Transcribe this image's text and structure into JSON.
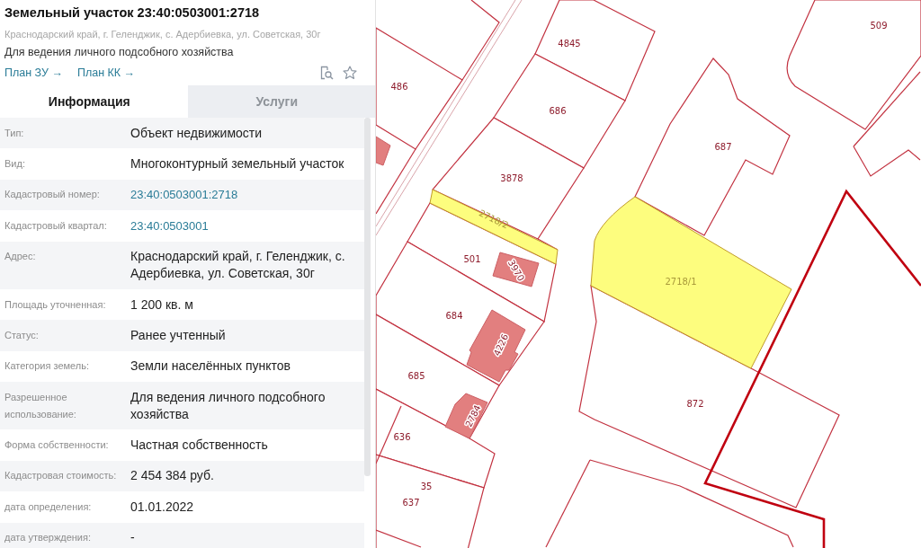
{
  "panel": {
    "title": "Земельный участок 23:40:0503001:2718",
    "address": "Краснодарский край, г. Геленджик, с. Адербиевка, ул. Советская, 30г",
    "purpose": "Для ведения личного подсобного хозяйства",
    "links": [
      "План ЗУ →",
      "План КК →"
    ],
    "tabs": [
      {
        "label": "Информация",
        "selected": true
      },
      {
        "label": "Услуги",
        "selected": false
      }
    ],
    "fields": [
      {
        "label": "Тип:",
        "value": "Объект недвижимости",
        "kind": "text"
      },
      {
        "label": "Вид:",
        "value": "Многоконтурный земельный участок",
        "kind": "text"
      },
      {
        "label": "Кадастровый номер:",
        "value": "23:40:0503001:2718",
        "kind": "link"
      },
      {
        "label": "Кадастровый квартал:",
        "value": "23:40:0503001",
        "kind": "link"
      },
      {
        "label": "Адрес:",
        "value": "Краснодарский край, г. Геленджик, с. Адербиевка, ул. Советская, 30г",
        "kind": "text"
      },
      {
        "label": "Площадь уточненная:",
        "value": "1 200 кв. м",
        "kind": "text"
      },
      {
        "label": "Статус:",
        "value": "Ранее учтенный",
        "kind": "text"
      },
      {
        "label": "Категория земель:",
        "value": "Земли населённых пунктов",
        "kind": "text"
      },
      {
        "label": "Разрешенное использование:",
        "value": "Для ведения личного подсобного хозяйства",
        "kind": "text"
      },
      {
        "label": "Форма собственности:",
        "value": "Частная собственность",
        "kind": "text"
      },
      {
        "label": "Кадастровая стоимость:",
        "value": "2 454 384 руб.",
        "kind": "text"
      },
      {
        "label": "дата определения:",
        "value": "01.01.2022",
        "kind": "text"
      },
      {
        "label": "дата утверждения:",
        "value": "-",
        "kind": "text"
      }
    ]
  },
  "map": {
    "parcels": [
      {
        "label": "4845",
        "kind": "plot"
      },
      {
        "label": "509",
        "kind": "plot"
      },
      {
        "label": "486",
        "kind": "plot"
      },
      {
        "label": "686",
        "kind": "plot"
      },
      {
        "label": "687",
        "kind": "plot"
      },
      {
        "label": "3878",
        "kind": "plot"
      },
      {
        "label": "2718/2",
        "kind": "selected"
      },
      {
        "label": "501",
        "kind": "plot"
      },
      {
        "label": "3970",
        "kind": "building"
      },
      {
        "label": "2718/1",
        "kind": "selected"
      },
      {
        "label": "684",
        "kind": "plot"
      },
      {
        "label": "4226",
        "kind": "building"
      },
      {
        "label": "685",
        "kind": "plot"
      },
      {
        "label": "872",
        "kind": "plot"
      },
      {
        "label": "2784",
        "kind": "building"
      },
      {
        "label": "636",
        "kind": "plot"
      },
      {
        "label": "35",
        "kind": "plot"
      },
      {
        "label": "637",
        "kind": "plot"
      }
    ]
  }
}
